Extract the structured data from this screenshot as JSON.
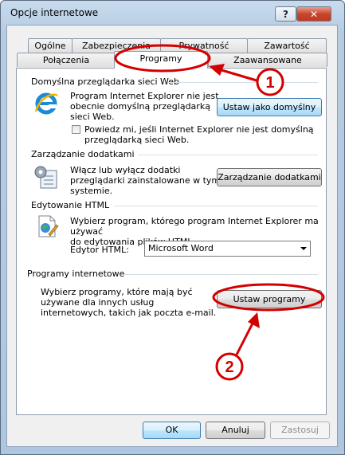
{
  "window": {
    "title": "Opcje internetowe",
    "help_glyph": "?",
    "close_glyph": "✕"
  },
  "tabs": {
    "row_back": [
      "Ogólne",
      "Zabezpieczenia",
      "Prywatność",
      "Zawartość"
    ],
    "row_front": [
      "Połączenia",
      "Programy",
      "Zaawansowane"
    ],
    "active": "Programy"
  },
  "default_browser": {
    "group_label": "Domyślna przeglądarka sieci Web",
    "text_lines": [
      "Program Internet Explorer nie jest",
      "obecnie domyślną przeglądarką",
      "sieci Web."
    ],
    "button_label": "Ustaw jako domyślny",
    "checkbox_lines": [
      "Powiedz mi, jeśli Internet Explorer nie jest domyślną",
      "przeglądarką sieci Web."
    ],
    "checkbox_checked": false,
    "icon": "internet-explorer-icon"
  },
  "addons": {
    "group_label": "Zarządzanie dodatkami",
    "text_lines": [
      "Włącz lub wyłącz dodatki",
      "przeglądarki zainstalowane w tym",
      "systemie."
    ],
    "button_label": "Zarządzanie dodatkami",
    "icon": "addons-gear-icon"
  },
  "html_editing": {
    "group_label": "Edytowanie HTML",
    "text_lines": [
      "Wybierz program, którego program Internet Explorer ma używać",
      "do edytowania plików HTML."
    ],
    "editor_label": "Edytor HTML:",
    "editor_value": "Microsoft Word",
    "icon": "html-editor-icon"
  },
  "internet_programs": {
    "group_label": "Programy internetowe",
    "text_lines": [
      "Wybierz programy, które mają być",
      "używane dla innych usług",
      "internetowych, takich jak poczta e-mail."
    ],
    "button_label": "Ustaw programy"
  },
  "annotations": {
    "marker_1": "1",
    "marker_2": "2",
    "color": "#d40000"
  },
  "footer": {
    "ok_label": "OK",
    "cancel_label": "Anuluj",
    "apply_label": "Zastosuj"
  }
}
